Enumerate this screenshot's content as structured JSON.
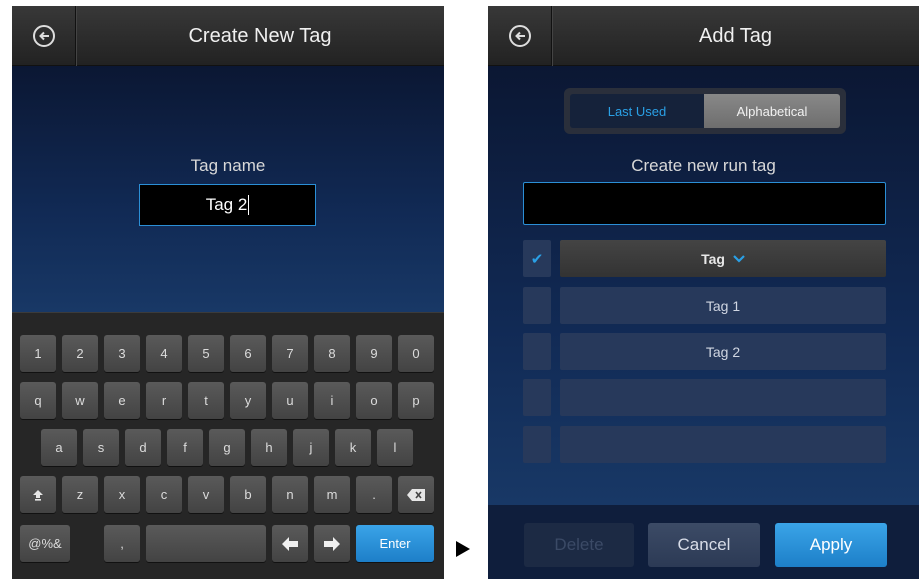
{
  "left_screen": {
    "title": "Create New Tag",
    "tag_name_label": "Tag name",
    "tag_name_value": "Tag 2",
    "keyboard": {
      "row1": [
        "1",
        "2",
        "3",
        "4",
        "5",
        "6",
        "7",
        "8",
        "9",
        "0"
      ],
      "row2": [
        "q",
        "w",
        "e",
        "r",
        "t",
        "y",
        "u",
        "i",
        "o",
        "p"
      ],
      "row3": [
        "a",
        "s",
        "d",
        "f",
        "g",
        "h",
        "j",
        "k",
        "l"
      ],
      "row4": [
        "z",
        "x",
        "c",
        "v",
        "b",
        "n",
        "m",
        "."
      ],
      "symbols_label": "@%&",
      "comma_label": ",",
      "enter_label": "Enter"
    }
  },
  "right_screen": {
    "title": "Add Tag",
    "sort_tabs": {
      "last_used": "Last Used",
      "alphabetical": "Alphabetical"
    },
    "create_label": "Create new run tag",
    "create_value": "",
    "list_header": "Tag",
    "tags": [
      "Tag 1",
      "Tag 2",
      "",
      ""
    ],
    "buttons": {
      "delete": "Delete",
      "cancel": "Cancel",
      "apply": "Apply"
    }
  },
  "colors": {
    "accent": "#2aa0e6",
    "background": "#0e1e3c"
  },
  "icons": [
    "back-arrow-icon",
    "shift-icon",
    "backspace-icon",
    "left-arrow-icon",
    "right-arrow-icon",
    "checkmark-icon",
    "chevron-down-icon",
    "play-triangle-icon"
  ]
}
